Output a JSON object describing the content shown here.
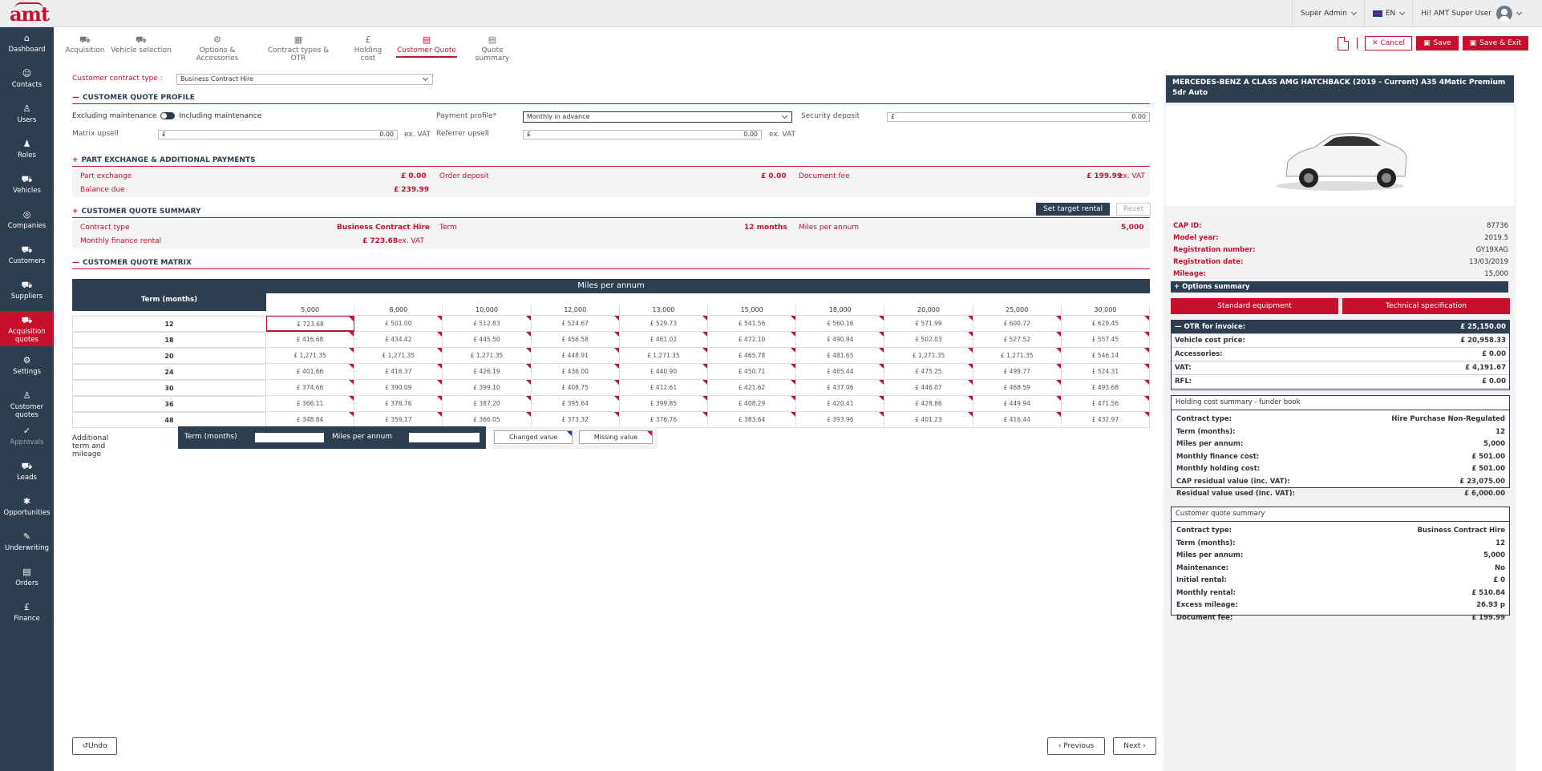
{
  "app": {
    "logo": "amt"
  },
  "top": {
    "role": "Super Admin",
    "lang": "EN",
    "greeting": "Hi! AMT Super User"
  },
  "sidebar": [
    {
      "label": "Dashboard",
      "icon": "home-icon",
      "glyph": "⌂"
    },
    {
      "label": "Contacts",
      "icon": "contacts-icon",
      "glyph": "☺"
    },
    {
      "label": "Users",
      "icon": "user-icon",
      "glyph": "♙"
    },
    {
      "label": "Roles",
      "icon": "roles-icon",
      "glyph": "♟"
    },
    {
      "label": "Vehicles",
      "icon": "car-icon",
      "glyph": "⛟"
    },
    {
      "label": "Companies",
      "icon": "companies-icon",
      "glyph": "◎"
    },
    {
      "label": "Customers",
      "icon": "customers-icon",
      "glyph": "⛟"
    },
    {
      "label": "Suppliers",
      "icon": "suppliers-icon",
      "glyph": "⛟"
    },
    {
      "label": "Acquisition quotes",
      "icon": "acquisition-icon",
      "glyph": "⛟"
    },
    {
      "label": "Settings",
      "icon": "gear-icon",
      "glyph": "⚙"
    },
    {
      "label": "Customer quotes",
      "icon": "customer-quotes-icon",
      "glyph": "♙"
    },
    {
      "label": "Approvals",
      "icon": "check-circle-icon",
      "glyph": "✓"
    },
    {
      "label": "Leads",
      "icon": "leads-icon",
      "glyph": "⛟"
    },
    {
      "label": "Opportunities",
      "icon": "opportunities-icon",
      "glyph": "✱"
    },
    {
      "label": "Underwriting",
      "icon": "underwriting-icon",
      "glyph": "✎"
    },
    {
      "label": "Orders",
      "icon": "orders-icon",
      "glyph": "▤"
    },
    {
      "label": "Finance",
      "icon": "pound-icon",
      "glyph": "£"
    }
  ],
  "tabs": [
    {
      "label": "Acquisition",
      "icon": "acquisition-tab-icon",
      "glyph": "⛟"
    },
    {
      "label": "Vehicle selection",
      "icon": "vehicle-tab-icon",
      "glyph": "⛟"
    },
    {
      "label": "Options & Accessories",
      "icon": "options-tab-icon",
      "glyph": "⚙"
    },
    {
      "label": "Contract types & OTR",
      "icon": "contract-tab-icon",
      "glyph": "▦"
    },
    {
      "label": "Holding cost",
      "icon": "holding-tab-icon",
      "glyph": "£"
    },
    {
      "label": "Customer Quote",
      "icon": "quote-tab-icon",
      "glyph": "▤"
    },
    {
      "label": "Quote summary",
      "icon": "summary-tab-icon",
      "glyph": "▤"
    }
  ],
  "actions": {
    "cancel": "Cancel",
    "save": "Save",
    "save_exit": "Save & Exit"
  },
  "contract": {
    "label": "Customer contract type :",
    "value": "Business Contract Hire"
  },
  "profile": {
    "heading": "CUSTOMER QUOTE PROFILE",
    "excl": "Excluding maintenance",
    "incl": "Including maintenance",
    "payment_label": "Payment profile*",
    "payment_value": "Monthly in advance",
    "security_label": "Security deposit",
    "security_value": "0.00",
    "matrix_label": "Matrix upsell",
    "matrix_value": "0.00",
    "referrer_label": "Referrer upsell",
    "referrer_value": "0.00",
    "currency": "£",
    "ex_vat": "ex. VAT"
  },
  "px": {
    "heading": "PART EXCHANGE & ADDITIONAL PAYMENTS",
    "part_label": "Part exchange",
    "part_value": "£ 0.00",
    "order_label": "Order deposit",
    "order_value": "£ 0.00",
    "doc_label": "Document fee",
    "doc_value": "£ 199.99",
    "doc_suffix": "ex. VAT",
    "bal_label": "Balance due",
    "bal_value": "£ 239.99"
  },
  "summary": {
    "heading": "CUSTOMER QUOTE SUMMARY",
    "set_target": "Set target rental",
    "reset": "Reset",
    "ct_label": "Contract type",
    "ct_value": "Business Contract Hire",
    "term_label": "Term",
    "term_value": "12 months",
    "miles_label": "Miles per annum",
    "miles_value": "5,000",
    "mfr_label": "Monthly finance rental",
    "mfr_value": "£ 723.68",
    "mfr_suffix": "ex. VAT"
  },
  "matrix": {
    "heading": "CUSTOMER QUOTE MATRIX",
    "title": "Miles per annum",
    "term_header": "Term (months)",
    "miles": [
      "5,000",
      "8,000",
      "10,000",
      "12,000",
      "13,000",
      "15,000",
      "18,000",
      "20,000",
      "25,000",
      "30,000"
    ],
    "rows": [
      {
        "term": "12",
        "values": [
          "£ 723.68",
          "£ 501.00",
          "£ 512.83",
          "£ 524.67",
          "£ 529.73",
          "£ 541.56",
          "£ 560.16",
          "£ 571.99",
          "£ 600.72",
          "£ 629.45"
        ]
      },
      {
        "term": "18",
        "values": [
          "£ 416.68",
          "£ 434.42",
          "£ 445.50",
          "£ 456.58",
          "£ 461.02",
          "£ 472.10",
          "£ 490.94",
          "£ 502.03",
          "£ 527.52",
          "£ 557.45"
        ]
      },
      {
        "term": "20",
        "values": [
          "£ 1,271.35",
          "£ 1,271.35",
          "£ 1,271.35",
          "£ 448.91",
          "£ 1,271.35",
          "£ 465.78",
          "£ 481.65",
          "£ 1,271.35",
          "£ 1,271.35",
          "£ 546.14"
        ]
      },
      {
        "term": "24",
        "values": [
          "£ 401.66",
          "£ 416.37",
          "£ 426.19",
          "£ 436.00",
          "£ 440.90",
          "£ 450.71",
          "£ 465.44",
          "£ 475.25",
          "£ 499.77",
          "£ 524.31"
        ]
      },
      {
        "term": "30",
        "values": [
          "£ 374.66",
          "£ 390.09",
          "£ 399.10",
          "£ 408.75",
          "£ 412.61",
          "£ 421.62",
          "£ 437.06",
          "£ 446.07",
          "£ 468.59",
          "£ 493.68"
        ]
      },
      {
        "term": "36",
        "values": [
          "£ 366.11",
          "£ 378.76",
          "£ 387.20",
          "£ 395.64",
          "£ 399.85",
          "£ 408.29",
          "£ 420.41",
          "£ 428.86",
          "£ 449.94",
          "£ 471.56"
        ]
      },
      {
        "term": "48",
        "values": [
          "£ 348.84",
          "£ 359.17",
          "£ 366.05",
          "£ 373.32",
          "£ 376.76",
          "£ 383.64",
          "£ 393.96",
          "£ 401.23",
          "£ 416.44",
          "£ 432.97"
        ]
      }
    ]
  },
  "additional": {
    "label": "Additional term and mileage",
    "term": "Term (months)",
    "miles": "Miles per annum",
    "changed": "Changed value",
    "missing": "Missing value"
  },
  "nav": {
    "undo": "Undo",
    "previous": "Previous",
    "next": "Next"
  },
  "vehicle": {
    "title": "MERCEDES-BENZ A CLASS AMG HATCHBACK (2019 - Current) A35 4Matic Premium 5dr Auto",
    "details": [
      {
        "k": "CAP ID:",
        "v": "87736"
      },
      {
        "k": "Model year:",
        "v": "2019.5"
      },
      {
        "k": "Registration number:",
        "v": "GY19XAG"
      },
      {
        "k": "Registration date:",
        "v": "13/03/2019"
      },
      {
        "k": "Mileage:",
        "v": "15,000"
      }
    ],
    "options_summary": "Options summary",
    "standard": "Standard equipment",
    "technical": "Technical specification",
    "otr": [
      {
        "k": "OTR for invoice:",
        "v": "£ 25,150.00"
      },
      {
        "k": "Vehicle cost price:",
        "v": "£ 20,958.33"
      },
      {
        "k": "Accessories:",
        "v": "£ 0.00"
      },
      {
        "k": "VAT:",
        "v": "£ 4,191.67"
      },
      {
        "k": "RFL:",
        "v": "£ 0.00"
      }
    ]
  },
  "holding": {
    "title": "Holding cost summary - funder book",
    "items": [
      {
        "k": "Contract type:",
        "v": "Hire Purchase Non-Regulated"
      },
      {
        "k": "Term (months):",
        "v": "12"
      },
      {
        "k": "Miles per annum:",
        "v": "5,000"
      },
      {
        "k": "Monthly finance cost:",
        "v": "£ 501.00"
      },
      {
        "k": "Monthly holding cost:",
        "v": "£ 501.00"
      },
      {
        "k": "CAP residual value (inc. VAT):",
        "v": "£ 23,075.00"
      },
      {
        "k": "Residual value used (inc. VAT):",
        "v": "£ 6,000.00"
      }
    ]
  },
  "cqsum": {
    "title": "Customer quote summary",
    "items": [
      {
        "k": "Contract type:",
        "v": "Business Contract Hire"
      },
      {
        "k": "Term (months):",
        "v": "12"
      },
      {
        "k": "Miles per annum:",
        "v": "5,000"
      },
      {
        "k": "Maintenance:",
        "v": "No"
      },
      {
        "k": "Initial rental:",
        "v": "£ 0"
      },
      {
        "k": "Monthly rental:",
        "v": "£ 510.84"
      },
      {
        "k": "Excess mileage:",
        "v": "26.93 p"
      },
      {
        "k": "Document fee:",
        "v": "£ 199.99"
      }
    ]
  }
}
